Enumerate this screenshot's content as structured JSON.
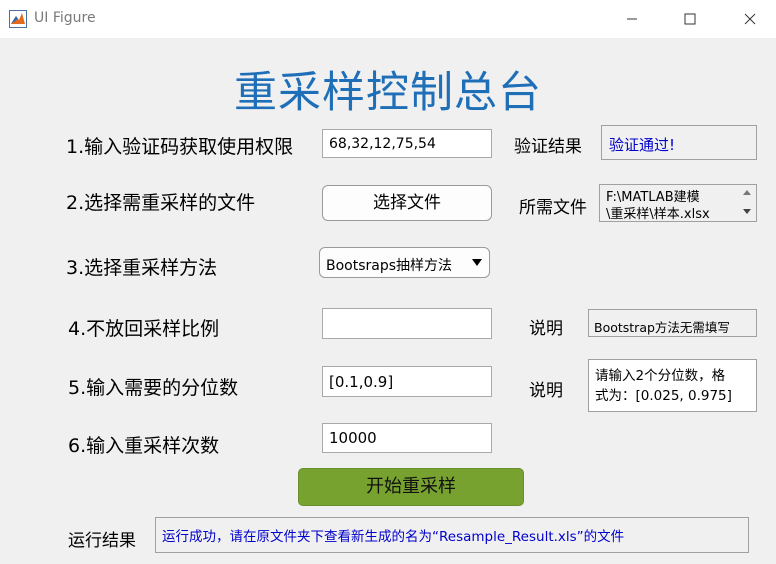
{
  "window": {
    "title": "UI Figure"
  },
  "heading": "重采样控制总台",
  "row1": {
    "label": "1.输入验证码获取使用权限",
    "input_value": "68,32,12,75,54",
    "result_label": "验证结果",
    "result_value": "验证通过!"
  },
  "row2": {
    "label": "2.选择需重采样的文件",
    "button_label": "选择文件",
    "file_label": "所需文件",
    "file_line1": "F:\\MATLAB建模",
    "file_line2": "\\重采样\\样本.xlsx"
  },
  "row3": {
    "label": "3.选择重采样方法",
    "selected": "Bootsraps抽样方法"
  },
  "row4": {
    "label": "4.不放回采样比例",
    "input_value": "",
    "note_label": "说明",
    "note_value": "Bootstrap方法无需填写"
  },
  "row5": {
    "label": "5.输入需要的分位数",
    "input_value": "[0.1,0.9]",
    "note_label": "说明",
    "note_line1": "请输入2个分位数，格",
    "note_line2": "式为：[0.025, 0.975]"
  },
  "row6": {
    "label": "6.输入重采样次数",
    "input_value": "10000"
  },
  "run_button": "开始重采样",
  "output": {
    "label": "运行结果",
    "value": "运行成功，请在原文件夹下查看新生成的名为“Resample_Result.xls”的文件"
  },
  "colors": {
    "heading": "#1f6fb8",
    "run_button": "#77a22f",
    "link_text": "#0000cc"
  }
}
